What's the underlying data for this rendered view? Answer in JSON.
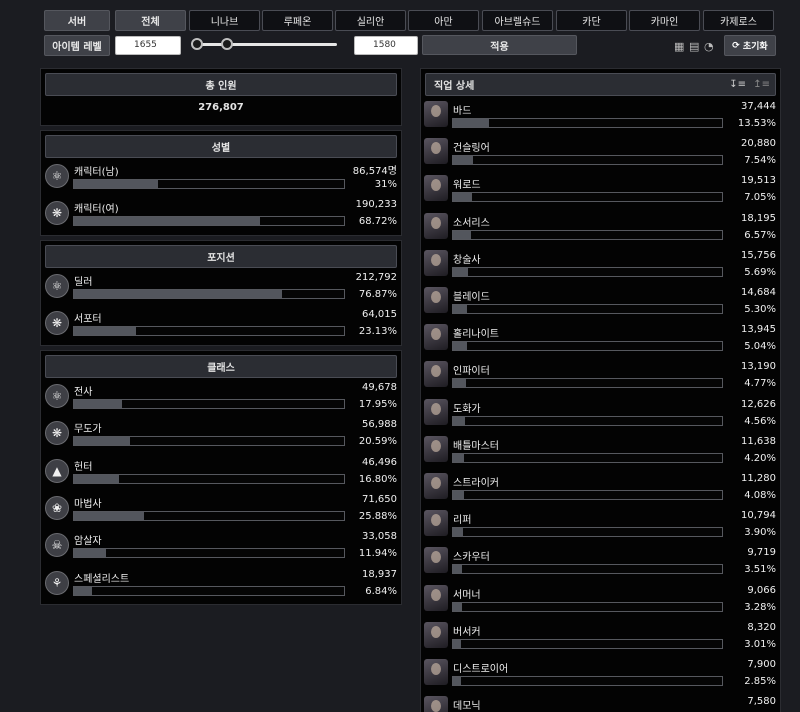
{
  "filters": {
    "server_label": "서버",
    "servers": [
      "전체",
      "니나브",
      "루페온",
      "실리안",
      "아만",
      "아브렐슈드",
      "카단",
      "카마인",
      "카제로스"
    ],
    "active_server": "전체",
    "item_level_label": "아이템 레벨",
    "item_level_min": "1655",
    "item_level_max": "1580",
    "apply_label": "적용",
    "reset_label": "초기화"
  },
  "total": {
    "title": "총 인원",
    "value": "276,807"
  },
  "gender": {
    "title": "성별",
    "rows": [
      {
        "label": "캐릭터(남)",
        "count": "86,574명",
        "pct": "31%",
        "ratio": 0.31,
        "icon": "male-emblem-icon"
      },
      {
        "label": "캐릭터(여)",
        "count": "190,233",
        "pct": "68.72%",
        "ratio": 0.6872,
        "icon": "female-emblem-icon"
      }
    ]
  },
  "position": {
    "title": "포지션",
    "rows": [
      {
        "label": "딜러",
        "count": "212,792",
        "pct": "76.87%",
        "ratio": 0.7687,
        "icon": "dealer-emblem-icon"
      },
      {
        "label": "서포터",
        "count": "64,015",
        "pct": "23.13%",
        "ratio": 0.2313,
        "icon": "support-emblem-icon"
      }
    ]
  },
  "class": {
    "title": "클래스",
    "rows": [
      {
        "label": "전사",
        "count": "49,678",
        "pct": "17.95%",
        "ratio": 0.1795,
        "icon": "warrior-emblem-icon"
      },
      {
        "label": "무도가",
        "count": "56,988",
        "pct": "20.59%",
        "ratio": 0.2059,
        "icon": "martial-artist-emblem-icon"
      },
      {
        "label": "헌터",
        "count": "46,496",
        "pct": "16.80%",
        "ratio": 0.168,
        "icon": "hunter-emblem-icon"
      },
      {
        "label": "마법사",
        "count": "71,650",
        "pct": "25.88%",
        "ratio": 0.2588,
        "icon": "mage-emblem-icon"
      },
      {
        "label": "암살자",
        "count": "33,058",
        "pct": "11.94%",
        "ratio": 0.1194,
        "icon": "assassin-emblem-icon"
      },
      {
        "label": "스페셜리스트",
        "count": "18,937",
        "pct": "6.84%",
        "ratio": 0.0684,
        "icon": "specialist-emblem-icon"
      }
    ]
  },
  "jobs": {
    "title": "직업 상세",
    "rows": [
      {
        "label": "바드",
        "count": "37,444",
        "pct": "13.53%",
        "ratio": 0.1353
      },
      {
        "label": "건슬링어",
        "count": "20,880",
        "pct": "7.54%",
        "ratio": 0.0754
      },
      {
        "label": "워로드",
        "count": "19,513",
        "pct": "7.05%",
        "ratio": 0.0705
      },
      {
        "label": "소서리스",
        "count": "18,195",
        "pct": "6.57%",
        "ratio": 0.0657
      },
      {
        "label": "창술사",
        "count": "15,756",
        "pct": "5.69%",
        "ratio": 0.0569
      },
      {
        "label": "블레이드",
        "count": "14,684",
        "pct": "5.30%",
        "ratio": 0.053
      },
      {
        "label": "홀리나이트",
        "count": "13,945",
        "pct": "5.04%",
        "ratio": 0.0504
      },
      {
        "label": "인파이터",
        "count": "13,190",
        "pct": "4.77%",
        "ratio": 0.0477
      },
      {
        "label": "도화가",
        "count": "12,626",
        "pct": "4.56%",
        "ratio": 0.0456
      },
      {
        "label": "배틀마스터",
        "count": "11,638",
        "pct": "4.20%",
        "ratio": 0.042
      },
      {
        "label": "스트라이커",
        "count": "11,280",
        "pct": "4.08%",
        "ratio": 0.0408
      },
      {
        "label": "리퍼",
        "count": "10,794",
        "pct": "3.90%",
        "ratio": 0.039
      },
      {
        "label": "스카우터",
        "count": "9,719",
        "pct": "3.51%",
        "ratio": 0.0351
      },
      {
        "label": "서머너",
        "count": "9,066",
        "pct": "3.28%",
        "ratio": 0.0328
      },
      {
        "label": "버서커",
        "count": "8,320",
        "pct": "3.01%",
        "ratio": 0.0301
      },
      {
        "label": "디스트로이어",
        "count": "7,900",
        "pct": "2.85%",
        "ratio": 0.0285
      },
      {
        "label": "데모닉",
        "count": "7,580",
        "pct": "",
        "ratio": 0.0274
      }
    ]
  }
}
